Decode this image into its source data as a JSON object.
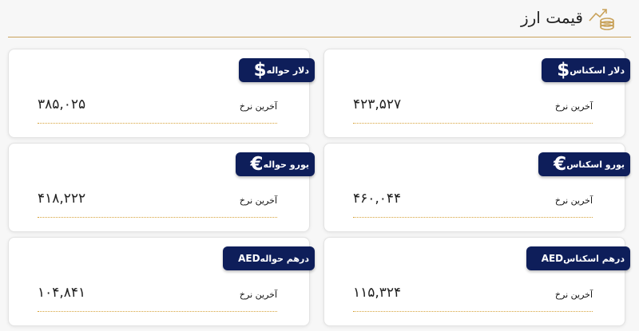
{
  "header": {
    "title": "قیمت ارز"
  },
  "cards": [
    {
      "symbol": "$",
      "label": "دلار اسکناس",
      "rate_label": "آخرین نرخ",
      "value": "۴۲۳,۵۲۷"
    },
    {
      "symbol": "$",
      "label": "دلار حواله",
      "rate_label": "آخرین نرخ",
      "value": "۳۸۵,۰۲۵"
    },
    {
      "symbol": "€",
      "label": "یورو اسکناس",
      "rate_label": "آخرین نرخ",
      "value": "۴۶۰,۰۴۴"
    },
    {
      "symbol": "€",
      "label": "یورو حواله",
      "rate_label": "آخرین نرخ",
      "value": "۴۱۸,۲۲۲"
    },
    {
      "symbol": "AED",
      "label": "درهم اسکناس",
      "rate_label": "آخرین نرخ",
      "value": "۱۱۵,۳۲۴"
    },
    {
      "symbol": "AED",
      "label": "درهم حواله",
      "rate_label": "آخرین نرخ",
      "value": "۱۰۴,۸۴۱"
    }
  ],
  "colors": {
    "badge_bg": "#0e1e5a",
    "accent_gold": "#c9a25a",
    "dotted": "#d6a33a"
  },
  "icons": {
    "header": "coins-trend-icon"
  }
}
